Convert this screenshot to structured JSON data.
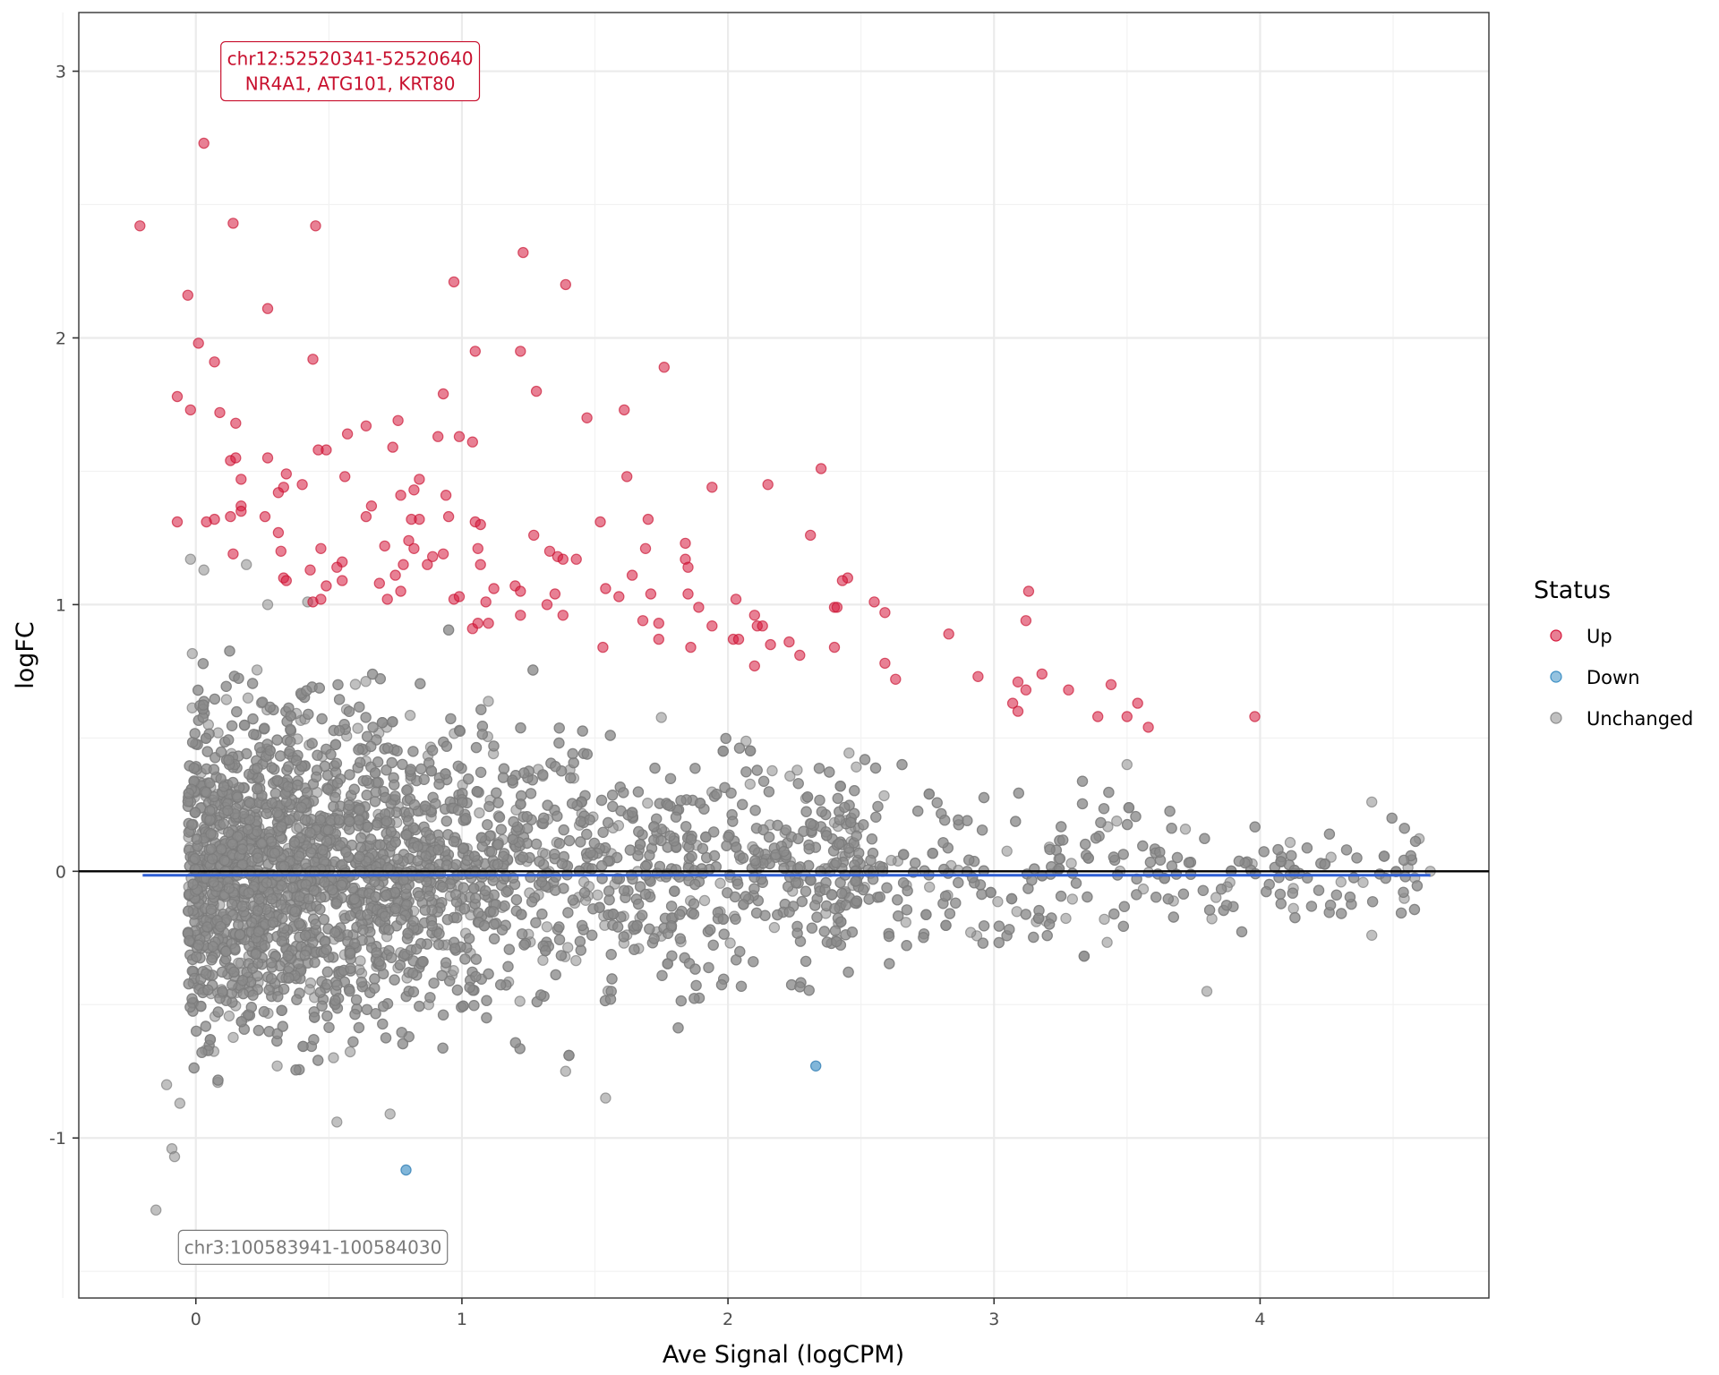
{
  "chart_data": {
    "type": "scatter",
    "title": "",
    "xlabel": "Ave Signal (logCPM)",
    "ylabel": "logFC",
    "xlim": [
      -0.44,
      4.86
    ],
    "ylim": [
      -1.6,
      3.22
    ],
    "x_ticks": [
      0,
      1,
      2,
      3,
      4
    ],
    "x_tick_labels": [
      "0",
      "1",
      "2",
      "3",
      "4"
    ],
    "y_ticks": [
      -1,
      0,
      1,
      2,
      3
    ],
    "y_tick_labels": [
      "-1",
      "0",
      "1",
      "2",
      "3"
    ],
    "grid": true,
    "reference_line": {
      "y": 0,
      "color": "#000000"
    },
    "trend_line": {
      "x": [
        -0.2,
        4.64
      ],
      "y": [
        -0.01,
        -0.01
      ],
      "color": "#2f5fd6"
    },
    "legend": {
      "title": "Status",
      "placement": "right",
      "entries": [
        {
          "label": "Up",
          "color": "#d6183c"
        },
        {
          "label": "Down",
          "color": "#3d8fc4"
        },
        {
          "label": "Unchanged",
          "color": "#8c8c8c"
        }
      ]
    },
    "annotations": [
      {
        "lines": [
          "chr12:52520341-52520640",
          "NR4A1, ATG101, KRT80"
        ],
        "x": 0.58,
        "y": 3.0,
        "color": "#c8102e"
      },
      {
        "lines": [
          "chr3:100583941-100584030"
        ],
        "x": 0.44,
        "y": -1.41,
        "color": "#7a7a7a"
      }
    ],
    "series": [
      {
        "name": "Up",
        "color": "#d6183c",
        "points": [
          [
            0.03,
            2.73
          ],
          [
            -0.21,
            2.42
          ],
          [
            0.14,
            2.43
          ],
          [
            0.45,
            2.42
          ],
          [
            1.23,
            2.32
          ],
          [
            1.39,
            2.2
          ],
          [
            0.97,
            2.21
          ],
          [
            -0.03,
            2.16
          ],
          [
            0.27,
            2.11
          ],
          [
            0.01,
            1.98
          ],
          [
            0.07,
            1.91
          ],
          [
            0.44,
            1.92
          ],
          [
            1.05,
            1.95
          ],
          [
            1.22,
            1.95
          ],
          [
            1.76,
            1.89
          ],
          [
            0.93,
            1.79
          ],
          [
            1.28,
            1.8
          ],
          [
            -0.07,
            1.78
          ],
          [
            -0.02,
            1.73
          ],
          [
            0.09,
            1.72
          ],
          [
            0.15,
            1.68
          ],
          [
            0.64,
            1.67
          ],
          [
            0.57,
            1.64
          ],
          [
            0.76,
            1.69
          ],
          [
            0.46,
            1.58
          ],
          [
            0.49,
            1.58
          ],
          [
            0.74,
            1.59
          ],
          [
            0.91,
            1.63
          ],
          [
            0.99,
            1.63
          ],
          [
            1.04,
            1.61
          ],
          [
            1.47,
            1.7
          ],
          [
            1.61,
            1.73
          ],
          [
            0.13,
            1.54
          ],
          [
            0.15,
            1.55
          ],
          [
            0.27,
            1.55
          ],
          [
            0.56,
            1.48
          ],
          [
            0.17,
            1.47
          ],
          [
            0.33,
            1.44
          ],
          [
            0.4,
            1.45
          ],
          [
            0.31,
            1.42
          ],
          [
            0.17,
            1.37
          ],
          [
            0.17,
            1.35
          ],
          [
            0.34,
            1.49
          ],
          [
            0.66,
            1.37
          ],
          [
            0.77,
            1.41
          ],
          [
            0.82,
            1.43
          ],
          [
            0.84,
            1.47
          ],
          [
            0.94,
            1.41
          ],
          [
            1.62,
            1.48
          ],
          [
            1.94,
            1.44
          ],
          [
            2.15,
            1.45
          ],
          [
            2.35,
            1.51
          ],
          [
            -0.07,
            1.31
          ],
          [
            0.04,
            1.31
          ],
          [
            0.07,
            1.32
          ],
          [
            0.13,
            1.33
          ],
          [
            0.26,
            1.33
          ],
          [
            0.31,
            1.27
          ],
          [
            0.64,
            1.33
          ],
          [
            0.81,
            1.32
          ],
          [
            0.84,
            1.32
          ],
          [
            0.95,
            1.33
          ],
          [
            1.05,
            1.31
          ],
          [
            1.07,
            1.3
          ],
          [
            1.27,
            1.26
          ],
          [
            1.52,
            1.31
          ],
          [
            1.7,
            1.32
          ],
          [
            2.31,
            1.26
          ],
          [
            0.14,
            1.19
          ],
          [
            0.32,
            1.2
          ],
          [
            0.47,
            1.21
          ],
          [
            0.55,
            1.16
          ],
          [
            0.71,
            1.22
          ],
          [
            0.8,
            1.24
          ],
          [
            0.82,
            1.21
          ],
          [
            0.89,
            1.18
          ],
          [
            0.93,
            1.19
          ],
          [
            1.06,
            1.21
          ],
          [
            1.33,
            1.2
          ],
          [
            1.36,
            1.18
          ],
          [
            1.38,
            1.17
          ],
          [
            1.43,
            1.17
          ],
          [
            1.64,
            1.11
          ],
          [
            1.69,
            1.21
          ],
          [
            1.84,
            1.23
          ],
          [
            1.84,
            1.17
          ],
          [
            1.85,
            1.14
          ],
          [
            0.33,
            1.1
          ],
          [
            0.34,
            1.09
          ],
          [
            0.43,
            1.13
          ],
          [
            0.53,
            1.14
          ],
          [
            0.55,
            1.09
          ],
          [
            0.69,
            1.08
          ],
          [
            0.75,
            1.11
          ],
          [
            0.78,
            1.15
          ],
          [
            0.87,
            1.15
          ],
          [
            1.07,
            1.15
          ],
          [
            1.2,
            1.07
          ],
          [
            1.22,
            1.05
          ],
          [
            1.12,
            1.06
          ],
          [
            1.35,
            1.04
          ],
          [
            1.54,
            1.06
          ],
          [
            1.59,
            1.03
          ],
          [
            2.45,
            1.1
          ],
          [
            2.43,
            1.09
          ],
          [
            3.13,
            1.05
          ],
          [
            0.44,
            1.01
          ],
          [
            0.47,
            1.02
          ],
          [
            0.49,
            1.07
          ],
          [
            0.72,
            1.02
          ],
          [
            0.77,
            1.05
          ],
          [
            0.97,
            1.02
          ],
          [
            0.99,
            1.03
          ],
          [
            1.09,
            1.01
          ],
          [
            1.32,
            1.0
          ],
          [
            1.38,
            0.96
          ],
          [
            1.71,
            1.04
          ],
          [
            1.85,
            1.04
          ],
          [
            2.03,
            1.02
          ],
          [
            2.4,
            0.99
          ],
          [
            2.41,
            0.99
          ],
          [
            2.55,
            1.01
          ],
          [
            2.59,
            0.97
          ],
          [
            1.22,
            0.96
          ],
          [
            1.04,
            0.91
          ],
          [
            1.06,
            0.93
          ],
          [
            1.1,
            0.93
          ],
          [
            1.74,
            0.93
          ],
          [
            1.89,
            0.99
          ],
          [
            1.94,
            0.92
          ],
          [
            2.1,
            0.96
          ],
          [
            2.11,
            0.92
          ],
          [
            2.13,
            0.92
          ],
          [
            2.02,
            0.87
          ],
          [
            2.04,
            0.87
          ],
          [
            1.68,
            0.94
          ],
          [
            1.74,
            0.87
          ],
          [
            1.86,
            0.84
          ],
          [
            2.16,
            0.85
          ],
          [
            2.23,
            0.86
          ],
          [
            2.4,
            0.84
          ],
          [
            2.27,
            0.81
          ],
          [
            1.53,
            0.84
          ],
          [
            2.1,
            0.77
          ],
          [
            2.59,
            0.78
          ],
          [
            2.63,
            0.72
          ],
          [
            2.83,
            0.89
          ],
          [
            3.12,
            0.94
          ],
          [
            2.94,
            0.73
          ],
          [
            3.09,
            0.71
          ],
          [
            3.18,
            0.74
          ],
          [
            3.12,
            0.68
          ],
          [
            3.07,
            0.63
          ],
          [
            3.09,
            0.6
          ],
          [
            3.28,
            0.68
          ],
          [
            3.44,
            0.7
          ],
          [
            3.54,
            0.63
          ],
          [
            3.39,
            0.58
          ],
          [
            3.5,
            0.58
          ],
          [
            3.58,
            0.54
          ],
          [
            3.98,
            0.58
          ]
        ]
      },
      {
        "name": "Down",
        "color": "#3d8fc4",
        "points": [
          [
            2.33,
            -0.73
          ],
          [
            0.79,
            -1.12
          ]
        ]
      },
      {
        "name": "Unchanged",
        "color": "#8c8c8c",
        "count_estimate": 5200,
        "x_range": [
          -0.15,
          4.64
        ],
        "spread_description": "dense band around logFC 0; spread ~±0.95 at low signal narrowing to ~±0.2 near signal 4.5; densest for signal 0–1.5",
        "outliers": [
          [
            -0.15,
            -1.27
          ],
          [
            -0.09,
            -1.04
          ],
          [
            -0.08,
            -1.07
          ],
          [
            -0.11,
            -0.8
          ],
          [
            -0.06,
            -0.87
          ],
          [
            0.53,
            -0.94
          ],
          [
            0.73,
            -0.91
          ],
          [
            1.54,
            -0.85
          ],
          [
            3.8,
            -0.45
          ],
          [
            4.42,
            -0.24
          ],
          [
            4.42,
            0.26
          ],
          [
            4.64,
            0.0
          ],
          [
            3.5,
            0.4
          ],
          [
            -0.02,
            1.17
          ],
          [
            0.03,
            1.13
          ],
          [
            0.42,
            1.01
          ],
          [
            0.27,
            1.0
          ],
          [
            0.19,
            1.15
          ]
        ]
      }
    ]
  }
}
